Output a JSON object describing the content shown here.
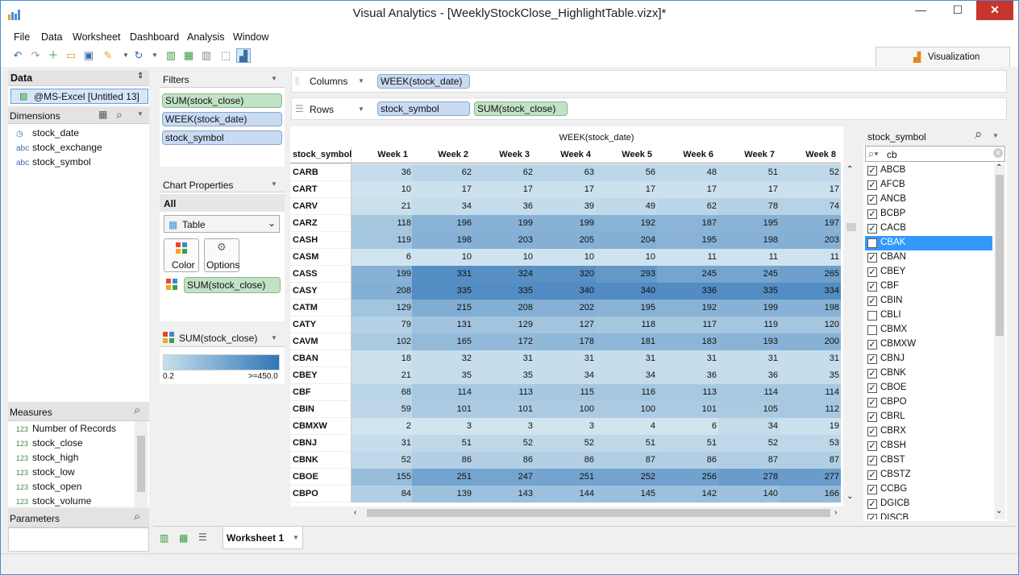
{
  "window": {
    "title": "Visual Analytics - [WeeklyStockClose_HighlightTable.vizx]*",
    "minimize": "—",
    "maximize": "☐",
    "close": "✕"
  },
  "menu": [
    "File",
    "Data",
    "Worksheet",
    "Dashboard",
    "Analysis",
    "Window"
  ],
  "visualization_tab": "Visualization",
  "data_panel": {
    "title": "Data",
    "source": "@MS-Excel [Untitled 13]",
    "dimensions_label": "Dimensions",
    "dimensions": [
      {
        "type": "date",
        "name": "stock_date"
      },
      {
        "type": "abc",
        "name": "stock_exchange"
      },
      {
        "type": "abc",
        "name": "stock_symbol"
      }
    ],
    "measures_label": "Measures",
    "measures": [
      "Number of Records",
      "stock_close",
      "stock_high",
      "stock_low",
      "stock_open",
      "stock_volume"
    ],
    "measure_type": "123",
    "parameters_label": "Parameters"
  },
  "filters": {
    "title": "Filters",
    "items": [
      "SUM(stock_close)",
      "WEEK(stock_date)",
      "stock_symbol"
    ]
  },
  "chart_properties": {
    "title": "Chart Properties",
    "scope": "All",
    "chart_type": "Table",
    "color_btn": "Color",
    "options_btn": "Options",
    "color_field": "SUM(stock_close)"
  },
  "legend": {
    "field": "SUM(stock_close)",
    "min": "0.2",
    "max": ">=450.0",
    "color_low": "#c6e0ec",
    "color_high": "#2f76b8"
  },
  "shelves": {
    "columns_label": "Columns",
    "columns": [
      "WEEK(stock_date)"
    ],
    "rows_label": "Rows",
    "rows": [
      "stock_symbol",
      "SUM(stock_close)"
    ]
  },
  "table": {
    "col_title": "WEEK(stock_date)",
    "row_header": "stock_symbol",
    "weeks": [
      "Week 1",
      "Week 2",
      "Week 3",
      "Week 4",
      "Week 5",
      "Week 6",
      "Week 7",
      "Week 8"
    ],
    "rows": [
      {
        "s": "CARB",
        "v": [
          36,
          62,
          62,
          63,
          56,
          48,
          51,
          52
        ]
      },
      {
        "s": "CART",
        "v": [
          10,
          17,
          17,
          17,
          17,
          17,
          17,
          17
        ]
      },
      {
        "s": "CARV",
        "v": [
          21,
          34,
          36,
          39,
          49,
          62,
          78,
          74
        ]
      },
      {
        "s": "CARZ",
        "v": [
          118,
          196,
          199,
          199,
          192,
          187,
          195,
          197
        ]
      },
      {
        "s": "CASH",
        "v": [
          119,
          198,
          203,
          205,
          204,
          195,
          198,
          203
        ]
      },
      {
        "s": "CASM",
        "v": [
          6,
          10,
          10,
          10,
          10,
          11,
          11,
          11
        ]
      },
      {
        "s": "CASS",
        "v": [
          199,
          331,
          324,
          320,
          293,
          245,
          245,
          265
        ]
      },
      {
        "s": "CASY",
        "v": [
          208,
          335,
          335,
          340,
          340,
          336,
          335,
          334
        ]
      },
      {
        "s": "CATM",
        "v": [
          129,
          215,
          208,
          202,
          195,
          192,
          199,
          198
        ]
      },
      {
        "s": "CATY",
        "v": [
          79,
          131,
          129,
          127,
          118,
          117,
          119,
          120
        ]
      },
      {
        "s": "CAVM",
        "v": [
          102,
          165,
          172,
          178,
          181,
          183,
          193,
          200
        ]
      },
      {
        "s": "CBAN",
        "v": [
          18,
          32,
          31,
          31,
          31,
          31,
          31,
          31
        ]
      },
      {
        "s": "CBEY",
        "v": [
          21,
          35,
          35,
          34,
          34,
          36,
          36,
          35
        ]
      },
      {
        "s": "CBF",
        "v": [
          68,
          114,
          113,
          115,
          116,
          113,
          114,
          114
        ]
      },
      {
        "s": "CBIN",
        "v": [
          59,
          101,
          101,
          100,
          100,
          101,
          105,
          112
        ]
      },
      {
        "s": "CBMXW",
        "v": [
          2,
          3,
          3,
          3,
          4,
          6,
          34,
          19
        ]
      },
      {
        "s": "CBNJ",
        "v": [
          31,
          51,
          52,
          52,
          51,
          51,
          52,
          53
        ]
      },
      {
        "s": "CBNK",
        "v": [
          52,
          86,
          86,
          86,
          87,
          86,
          87,
          87
        ]
      },
      {
        "s": "CBOE",
        "v": [
          155,
          251,
          247,
          251,
          252,
          256,
          278,
          277
        ]
      },
      {
        "s": "CBPO",
        "v": [
          84,
          139,
          143,
          144,
          145,
          142,
          140,
          166
        ]
      }
    ]
  },
  "symbol_filter": {
    "title": "stock_symbol",
    "search": "cb",
    "items": [
      {
        "n": "ABCB",
        "c": true
      },
      {
        "n": "AFCB",
        "c": true
      },
      {
        "n": "ANCB",
        "c": true
      },
      {
        "n": "BCBP",
        "c": true
      },
      {
        "n": "CACB",
        "c": true
      },
      {
        "n": "CBAK",
        "c": false,
        "sel": true
      },
      {
        "n": "CBAN",
        "c": true
      },
      {
        "n": "CBEY",
        "c": true
      },
      {
        "n": "CBF",
        "c": true
      },
      {
        "n": "CBIN",
        "c": true
      },
      {
        "n": "CBLI",
        "c": false
      },
      {
        "n": "CBMX",
        "c": false
      },
      {
        "n": "CBMXW",
        "c": true
      },
      {
        "n": "CBNJ",
        "c": true
      },
      {
        "n": "CBNK",
        "c": true
      },
      {
        "n": "CBOE",
        "c": true
      },
      {
        "n": "CBPO",
        "c": true
      },
      {
        "n": "CBRL",
        "c": true
      },
      {
        "n": "CBRX",
        "c": true
      },
      {
        "n": "CBSH",
        "c": true
      },
      {
        "n": "CBST",
        "c": true
      },
      {
        "n": "CBSTZ",
        "c": true
      },
      {
        "n": "CCBG",
        "c": true
      },
      {
        "n": "DGICB",
        "c": true
      },
      {
        "n": "DISCB",
        "c": true
      }
    ]
  },
  "sheet_tab": "Worksheet 1"
}
